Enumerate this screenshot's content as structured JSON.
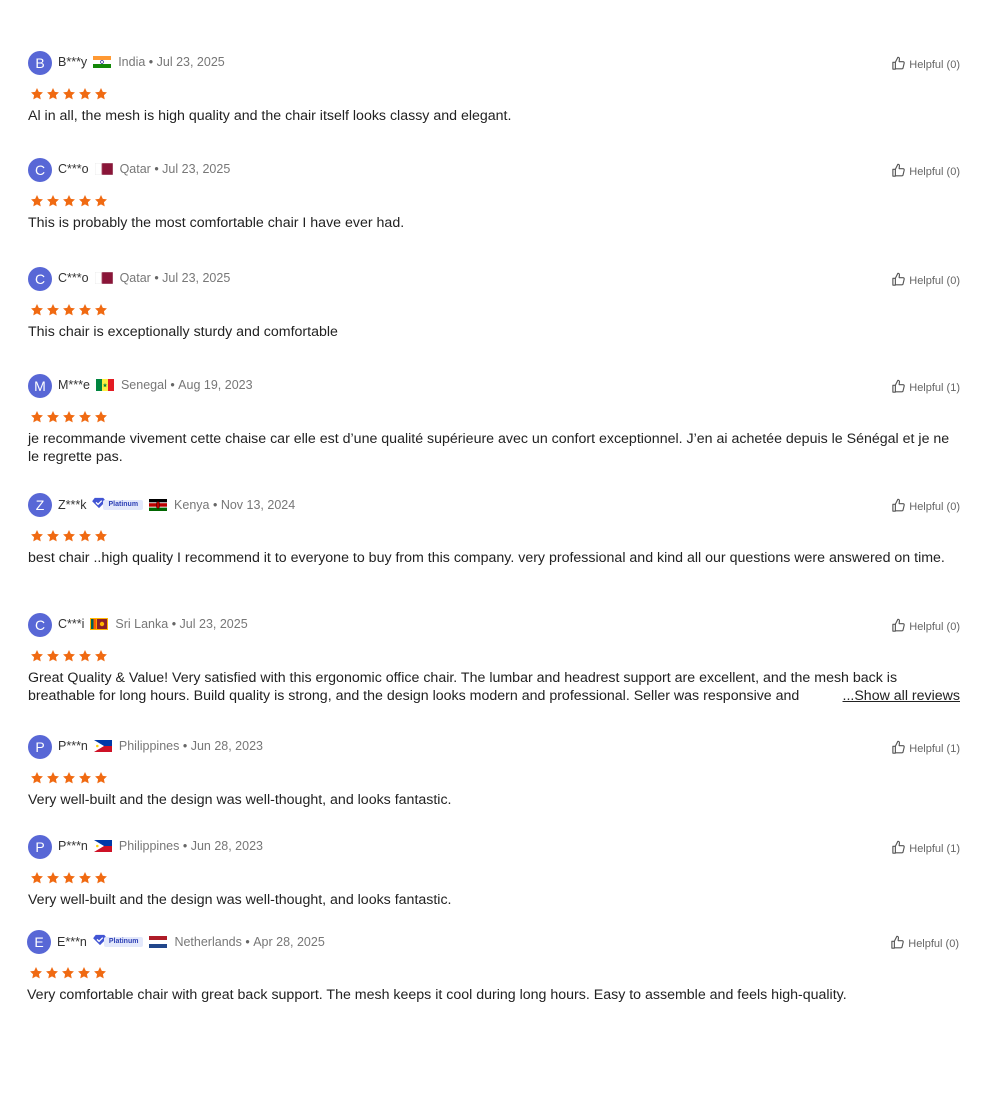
{
  "colors": {
    "avatar": "#5867d6",
    "star": "#f06a12",
    "platinum_badge": "#e3e8fb"
  },
  "icons": {
    "rating_star": "star-icon",
    "helpful": "thumbs-up-icon",
    "platinum": "diamond-check-icon"
  },
  "reviews": [
    {
      "initial": "B",
      "user": "B***y",
      "country": "India",
      "date": "Jul 23, 2025",
      "rating": 5,
      "helpful": "Helpful (0)",
      "text": "Al in all, the mesh is high quality and the chair itself looks classy and elegant."
    },
    {
      "initial": "C",
      "user": "C***o",
      "country": "Qatar",
      "date": "Jul 23, 2025",
      "rating": 5,
      "helpful": "Helpful (0)",
      "text": "This is probably the most comfortable chair I have ever had."
    },
    {
      "initial": "C",
      "user": "C***o",
      "country": "Qatar",
      "date": "Jul 23, 2025",
      "rating": 5,
      "helpful": "Helpful (0)",
      "text": "This chair is exceptionally sturdy and comfortable"
    },
    {
      "initial": "M",
      "user": "M***e",
      "country": "Senegal",
      "date": "Aug 19, 2023",
      "rating": 5,
      "helpful": "Helpful (1)",
      "text": "je recommande vivement cette chaise car elle est d’une qualité supérieure avec un confort exceptionnel. J’en ai achetée depuis le Sénégal et je ne le regrette pas."
    },
    {
      "initial": "Z",
      "user": "Z***k",
      "badge": "Platinum",
      "country": "Kenya",
      "date": "Nov 13, 2024",
      "rating": 5,
      "helpful": "Helpful (0)",
      "text": "best chair ..high quality I recommend it to everyone to buy from this company. very professional and kind all our questions were answered on time."
    },
    {
      "initial": "C",
      "user": "C***i",
      "country": "Sri Lanka",
      "date": "Jul 23, 2025",
      "rating": 5,
      "helpful": "Helpful (0)",
      "text": "Great Quality & Value! Very satisfied with this ergonomic office chair. The lumbar and headrest support are excellent, and the mesh back is breathable for long hours. Build quality is strong, and the design looks modern and professional. Seller was responsive and",
      "show_all": "...Show all reviews"
    },
    {
      "initial": "P",
      "user": "P***n",
      "country": "Philippines",
      "date": "Jun 28, 2023",
      "rating": 5,
      "helpful": "Helpful (1)",
      "text": "Very well-built and the design was well-thought, and looks fantastic."
    },
    {
      "initial": "P",
      "user": "P***n",
      "country": "Philippines",
      "date": "Jun 28, 2023",
      "rating": 5,
      "helpful": "Helpful (1)",
      "text": "Very well-built and the design was well-thought, and looks fantastic."
    },
    {
      "initial": "E",
      "user": "E***n",
      "badge": "Platinum",
      "country": "Netherlands",
      "date": "Apr 28, 2025",
      "rating": 5,
      "helpful": "Helpful (0)",
      "text": "Very comfortable chair with great back support. The mesh keeps it cool during long hours. Easy to assemble and feels high-quality."
    }
  ]
}
